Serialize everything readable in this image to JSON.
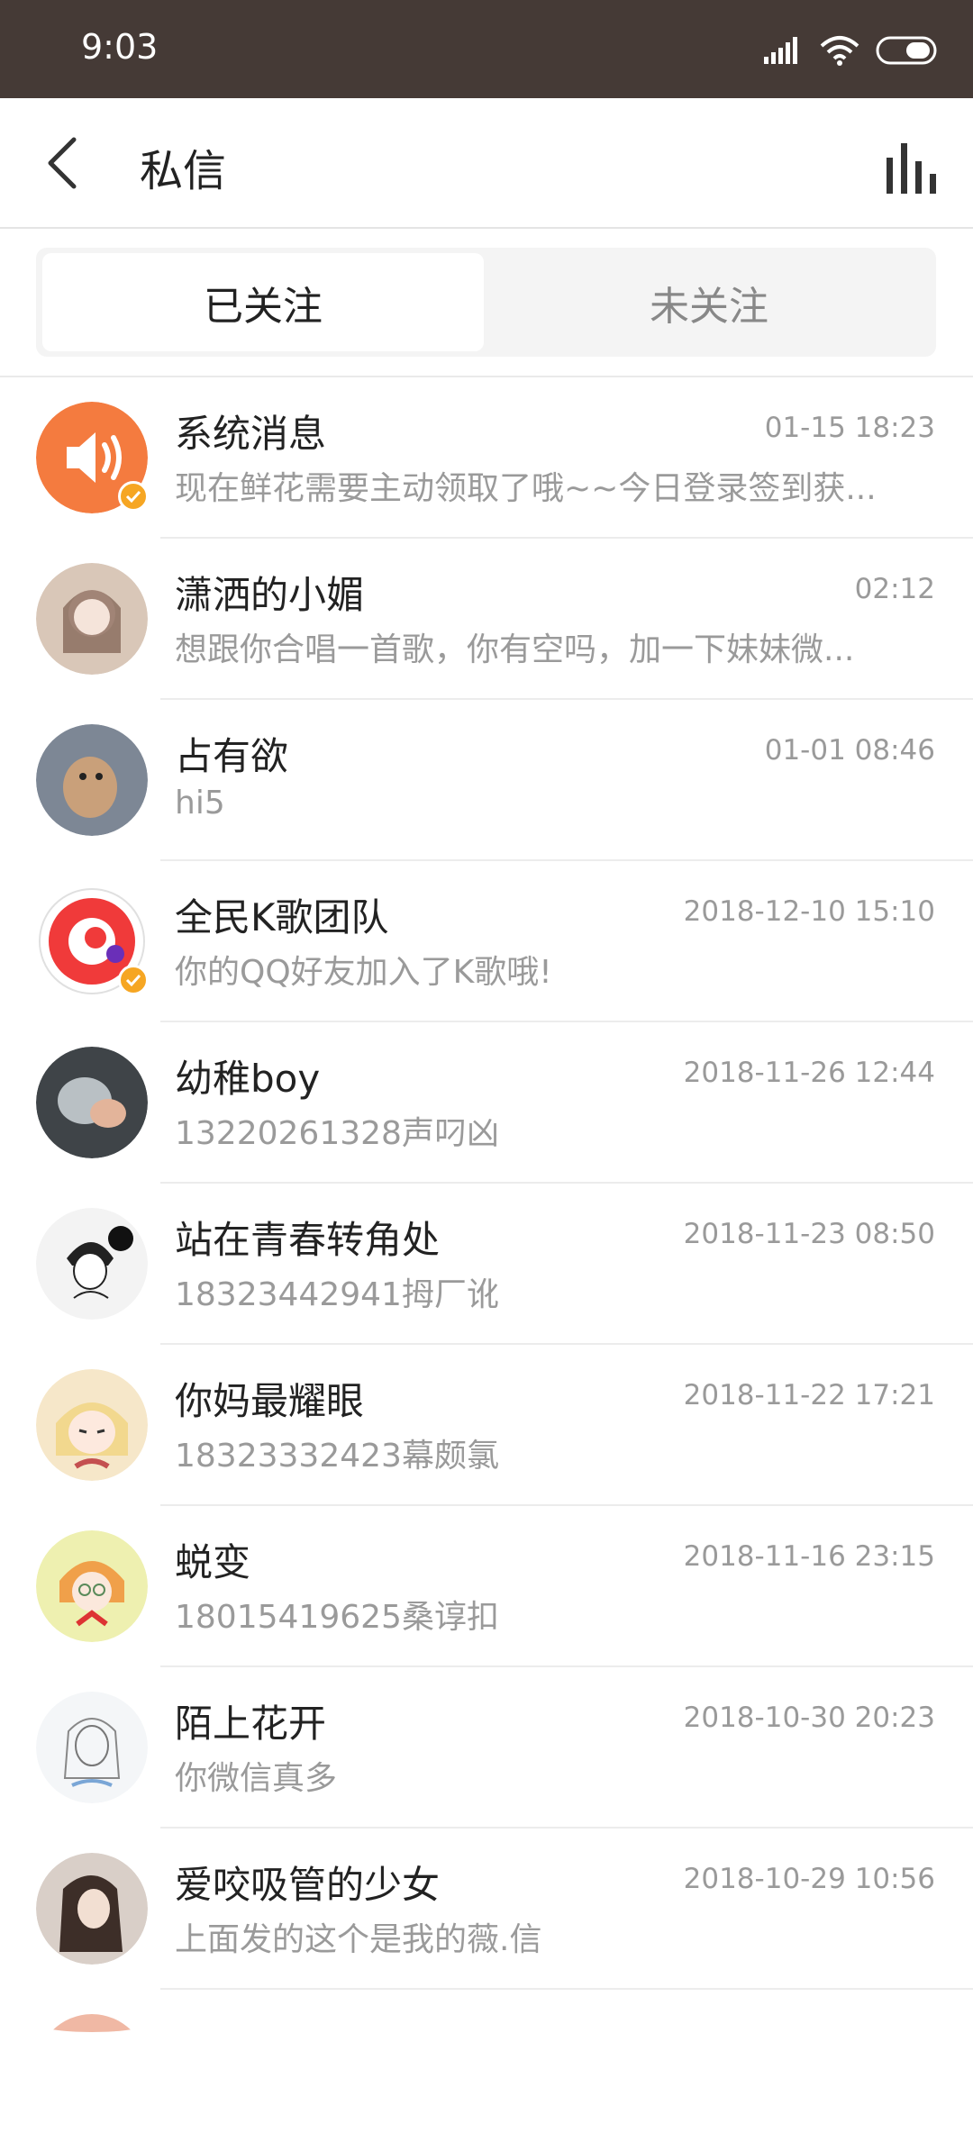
{
  "status_bar": {
    "time": "9:03"
  },
  "header": {
    "title": "私信"
  },
  "segment": {
    "tabs": [
      "已关注",
      "未关注"
    ],
    "active": "已关注"
  },
  "messages": [
    {
      "name": "系统消息",
      "time": "01-15 18:23",
      "preview": "现在鲜花需要主动领取了哦~~今日登录签到获...",
      "verified": true
    },
    {
      "name": "潇洒的小媚",
      "time": "02:12",
      "preview": "想跟你合唱一首歌，你有空吗，加一下妹妹微...",
      "verified": false
    },
    {
      "name": "占有欲",
      "time": "01-01 08:46",
      "preview": "hi5",
      "verified": false
    },
    {
      "name": "全民K歌团队",
      "time": "2018-12-10 15:10",
      "preview": "你的QQ好友加入了K歌哦!",
      "verified": true
    },
    {
      "name": "幼稚boy",
      "time": "2018-11-26 12:44",
      "preview": "13220261328声叼凶",
      "verified": false
    },
    {
      "name": "站在青春转角处",
      "time": "2018-11-23 08:50",
      "preview": "18323442941拇厂讹",
      "verified": false
    },
    {
      "name": "你妈最耀眼",
      "time": "2018-11-22 17:21",
      "preview": "18323332423幕颇氯",
      "verified": false
    },
    {
      "name": "蜕变",
      "time": "2018-11-16 23:15",
      "preview": "18015419625桑谆扣",
      "verified": false
    },
    {
      "name": "陌上花开",
      "time": "2018-10-30 20:23",
      "preview": "你微信真多",
      "verified": false
    },
    {
      "name": "爱咬吸管的少女",
      "time": "2018-10-29 10:56",
      "preview": "上面发的这个是我的薇.信",
      "verified": false
    }
  ],
  "colors": {
    "status_bar": "#453a36",
    "accent_orange": "#f47b3f",
    "badge": "#f6a623",
    "text_secondary": "#9a9a9a"
  },
  "icons": [
    "signal-icon",
    "wifi-icon",
    "battery-icon",
    "back-arrow-icon",
    "bar-chart-icon",
    "speaker-icon",
    "verified-badge-icon"
  ]
}
